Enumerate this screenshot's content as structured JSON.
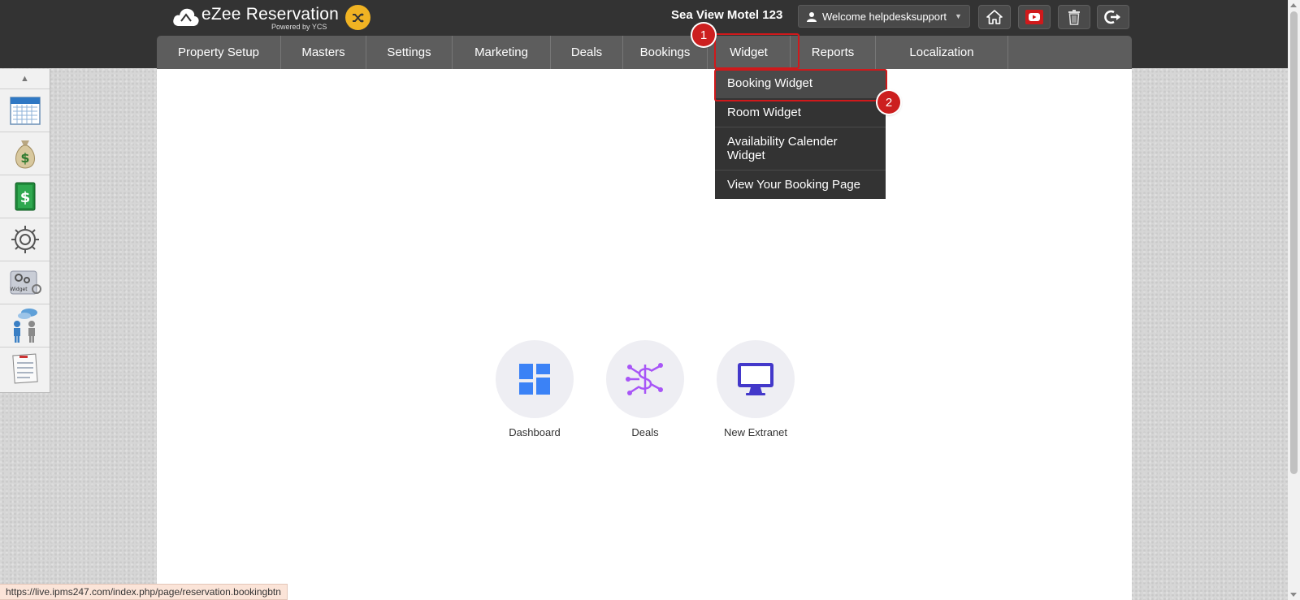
{
  "app": {
    "name": "eZee Reservation",
    "powered_by": "Powered by YCS",
    "property_name": "Sea View Motel 123",
    "welcome_text": "Welcome helpdesksupport"
  },
  "nav": {
    "items": [
      {
        "label": "Property Setup"
      },
      {
        "label": "Masters"
      },
      {
        "label": "Settings"
      },
      {
        "label": "Marketing"
      },
      {
        "label": "Deals"
      },
      {
        "label": "Bookings"
      },
      {
        "label": "Widget"
      },
      {
        "label": "Reports"
      },
      {
        "label": "Localization"
      }
    ],
    "active": "Widget"
  },
  "dropdown": {
    "items": [
      {
        "label": "Booking Widget"
      },
      {
        "label": "Room Widget"
      },
      {
        "label": "Availability Calender Widget"
      },
      {
        "label": "View Your Booking Page"
      }
    ]
  },
  "annotations": {
    "step1": "1",
    "step2": "2"
  },
  "tiles": [
    {
      "label": "Dashboard",
      "icon": "dashboard-icon",
      "color": "#3b82f6"
    },
    {
      "label": "Deals",
      "icon": "deals-icon",
      "color": "#a855f7"
    },
    {
      "label": "New Extranet",
      "icon": "monitor-icon",
      "color": "#4338ca"
    }
  ],
  "sidebar_icons": [
    "calendar-icon",
    "money-bag-icon",
    "cash-icon",
    "gear-icon",
    "widget-icon",
    "users-chat-icon",
    "task-list-icon"
  ],
  "status_url": "https://live.ipms247.com/index.php/page/reservation.bookingbtn",
  "colors": {
    "topbar": "#333333",
    "nav": "#5d5d5d",
    "highlight": "#d0191b",
    "shuffle": "#f0b323"
  }
}
